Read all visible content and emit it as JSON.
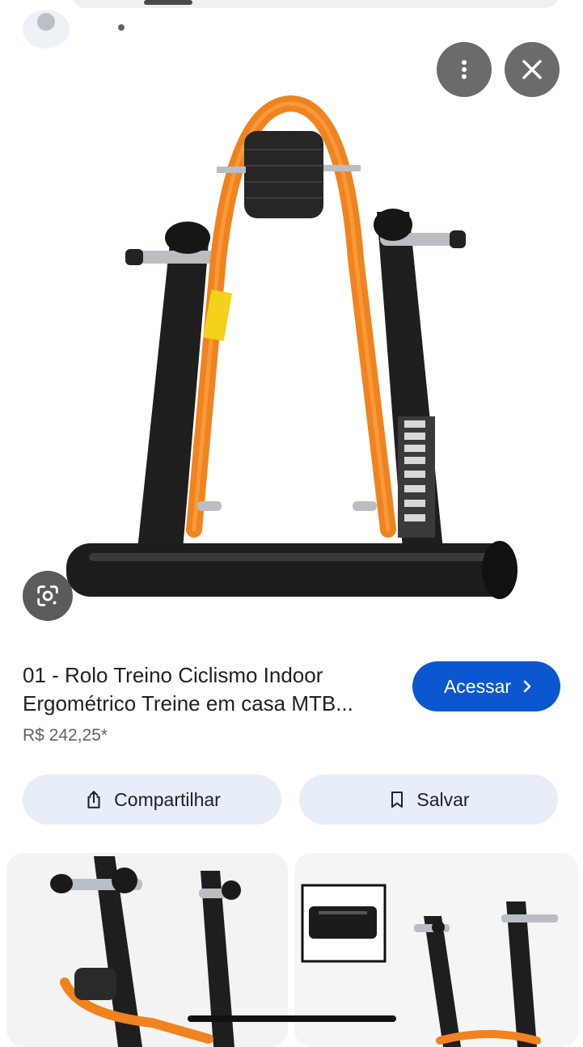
{
  "product": {
    "title": "01 - Rolo Treino Ciclismo Indoor Ergométrico Treine em casa MTB...",
    "price": "R$ 242,25*"
  },
  "buttons": {
    "visit_label": "Acessar",
    "share_label": "Compartilhar",
    "save_label": "Salvar"
  },
  "icons": {
    "more": "more-vert-icon",
    "close": "close-icon",
    "lens": "google-lens-icon",
    "share": "share-icon",
    "save": "bookmark-icon",
    "visit": "chevron-right-icon"
  },
  "colors": {
    "accent": "#0b57d0",
    "tonal_button": "#e8eef9",
    "overlay_button": "#6b6b6b"
  }
}
